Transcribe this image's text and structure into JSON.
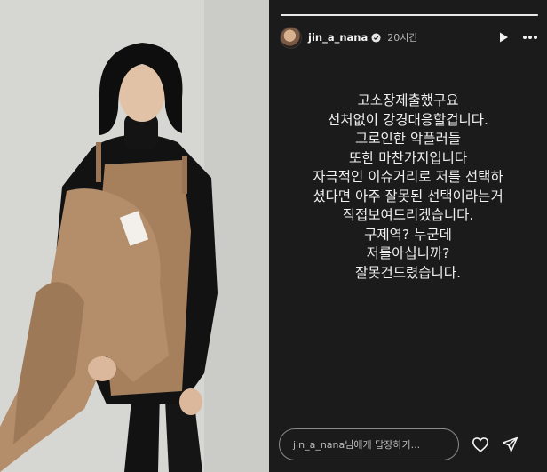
{
  "story": {
    "username": "jin_a_nana",
    "timestamp": "20시간",
    "progress_fraction": 1.0,
    "lines": [
      "고소장제출했구요",
      "선처없이 강경대응할겁니다.",
      "그로인한 악플러들",
      "또한 마찬가지입니다",
      "자극적인 이슈거리로 저를 선택하",
      "셨다면 아주 잘못된 선택이라는거",
      "직접보여드리겠습니다.",
      "구제역? 누군데",
      "저를아십니까?",
      "잘못건드렸습니다."
    ],
    "reply_placeholder": "jin_a_nana님에게 답장하기...",
    "icons": {
      "verified": "verified-badge-icon",
      "play": "play-icon",
      "more": "more-options-icon",
      "like": "heart-icon",
      "send": "send-icon"
    }
  },
  "photo": {
    "icons": {
      "subject": "portrait-photo"
    }
  }
}
